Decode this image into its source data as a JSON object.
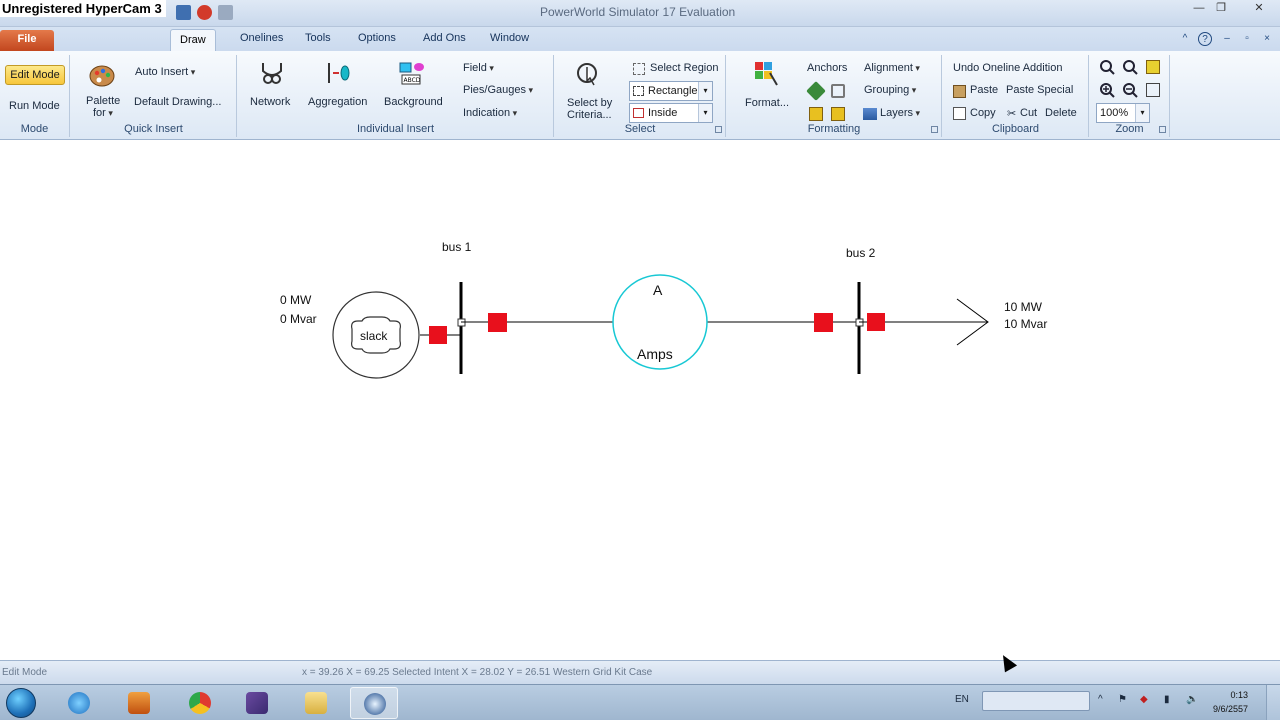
{
  "window": {
    "watermark": "Unregistered HyperCam 3",
    "title": "PowerWorld Simulator 17 Evaluation",
    "controls": [
      "—",
      "❐",
      "✕"
    ]
  },
  "tabs": {
    "file": "File",
    "items": [
      "Draw",
      "Onelines",
      "Tools",
      "Options",
      "Add Ons",
      "Window"
    ],
    "active": "Draw"
  },
  "ribbon": {
    "mode": {
      "edit": "Edit Mode",
      "run": "Run Mode",
      "label": "Mode"
    },
    "quick_insert": {
      "palette": "Palette",
      "palette_for": "for",
      "auto_insert": "Auto Insert",
      "default_drawing": "Default Drawing...",
      "label": "Quick Insert"
    },
    "individual_insert": {
      "network": "Network",
      "aggregation": "Aggregation",
      "background": "Background",
      "field": "Field",
      "pies_gauges": "Pies/Gauges",
      "indication": "Indication",
      "label": "Individual Insert"
    },
    "select": {
      "select_by": "Select by",
      "criteria": "Criteria...",
      "select_region": "Select Region",
      "shape": "Rectangle",
      "mode": "Inside",
      "label": "Select"
    },
    "formatting": {
      "format": "Format...",
      "anchors": "Anchors",
      "alignment": "Alignment",
      "grouping": "Grouping",
      "layers": "Layers",
      "label": "Formatting"
    },
    "clipboard": {
      "undo": "Undo Oneline Addition",
      "paste": "Paste",
      "paste_special": "Paste Special",
      "copy": "Copy",
      "cut": "Cut",
      "delete": "Delete",
      "label": "Clipboard"
    },
    "zoom": {
      "level": "100%",
      "label": "Zoom"
    }
  },
  "diagram": {
    "bus1": "bus 1",
    "bus2": "bus 2",
    "gen_mw": "0 MW",
    "gen_mvar": "0 Mvar",
    "slack": "slack",
    "meter_unit": "A",
    "meter_label": "Amps",
    "load_mw": "10 MW",
    "load_mvar": "10 Mvar",
    "colors": {
      "breaker": "#e8101c",
      "meter": "#18c8d4",
      "line": "#000000"
    }
  },
  "status": {
    "mode": "Edit Mode",
    "coords": "x = 39.26 X = 69.25 Selected Intent X = 28.02 Y = 26.51 Western Grid Kit Case"
  },
  "taskbar": {
    "lang": "EN",
    "time": "0:13",
    "date": "9/6/2557",
    "apps": [
      "explorer-icon",
      "ie-icon",
      "media-icon",
      "chrome-icon",
      "vs-icon",
      "folder-icon",
      "powerworld-icon"
    ]
  }
}
